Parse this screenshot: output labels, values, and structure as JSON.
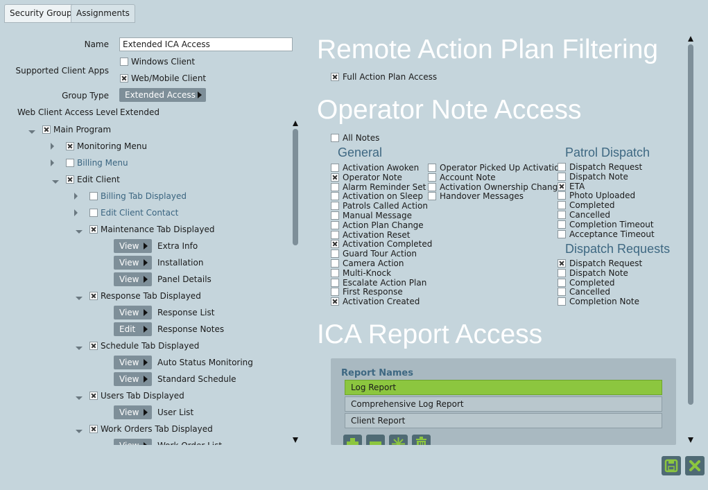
{
  "tabs": [
    "Security Group",
    "Assignments"
  ],
  "form": {
    "name_label": "Name",
    "name_value": "Extended ICA Access",
    "client_apps_label": "Supported Client Apps",
    "client_apps": [
      {
        "label": "Windows Client",
        "checked": false
      },
      {
        "label": "Web/Mobile Client",
        "checked": true
      }
    ],
    "group_type_label": "Group Type",
    "group_type_value": "Extended Access",
    "web_access_label": "Web Client Access Level",
    "web_access_value": "Extended"
  },
  "tree": [
    {
      "label": "Main Program",
      "checked": true
    },
    {
      "label": "Monitoring Menu",
      "checked": true
    },
    {
      "label": "Billing Menu",
      "checked": false
    },
    {
      "label": "Edit Client",
      "checked": true
    },
    {
      "label": "Billing Tab Displayed",
      "checked": false
    },
    {
      "label": "Edit Client Contact",
      "checked": false
    },
    {
      "label": "Maintenance Tab Displayed",
      "checked": true
    },
    {
      "mode": "View",
      "label": "Extra Info"
    },
    {
      "mode": "View",
      "label": "Installation"
    },
    {
      "mode": "View",
      "label": "Panel Details"
    },
    {
      "label": "Response Tab Displayed",
      "checked": true
    },
    {
      "mode": "View",
      "label": "Response List"
    },
    {
      "mode": "Edit",
      "label": "Response Notes"
    },
    {
      "label": "Schedule Tab Displayed",
      "checked": true
    },
    {
      "mode": "View",
      "label": "Auto Status Monitoring"
    },
    {
      "mode": "View",
      "label": "Standard Schedule"
    },
    {
      "label": "Users Tab Displayed",
      "checked": true
    },
    {
      "mode": "View",
      "label": "User List"
    },
    {
      "label": "Work Orders Tab Displayed",
      "checked": true
    },
    {
      "mode": "View",
      "label": "Work Order List"
    }
  ],
  "remote": {
    "title": "Remote Action Plan Filtering",
    "full_access": {
      "label": "Full Action Plan Access",
      "checked": true
    }
  },
  "operator_notes": {
    "title": "Operator Note Access",
    "all_notes": {
      "label": "All Notes",
      "checked": false
    },
    "general_heading": "General",
    "general_col1": [
      {
        "label": "Activation Awoken",
        "checked": false
      },
      {
        "label": "Operator Note",
        "checked": true
      },
      {
        "label": "Alarm Reminder Set",
        "checked": false
      },
      {
        "label": "Activation on Sleep",
        "checked": false
      },
      {
        "label": "Patrols Called Action",
        "checked": false
      },
      {
        "label": "Manual Message",
        "checked": false
      },
      {
        "label": "Action Plan Change",
        "checked": false
      },
      {
        "label": "Activation Reset",
        "checked": false
      },
      {
        "label": "Activation Completed",
        "checked": true
      },
      {
        "label": "Guard Tour Action",
        "checked": false
      },
      {
        "label": "Camera Action",
        "checked": false
      },
      {
        "label": "Multi-Knock",
        "checked": false
      },
      {
        "label": "Escalate Action Plan",
        "checked": false
      },
      {
        "label": "First Response",
        "checked": false
      },
      {
        "label": "Activation Created",
        "checked": true
      }
    ],
    "general_col2": [
      {
        "label": "Operator Picked Up Activation",
        "checked": false
      },
      {
        "label": "Account Note",
        "checked": false
      },
      {
        "label": "Activation Ownership Change",
        "checked": false
      },
      {
        "label": "Handover Messages",
        "checked": false
      }
    ],
    "patrol_heading": "Patrol Dispatch",
    "patrol": [
      {
        "label": "Dispatch Request",
        "checked": false
      },
      {
        "label": "Dispatch Note",
        "checked": false
      },
      {
        "label": "ETA",
        "checked": true
      },
      {
        "label": "Photo Uploaded",
        "checked": false
      },
      {
        "label": "Completed",
        "checked": false
      },
      {
        "label": "Cancelled",
        "checked": false
      },
      {
        "label": "Completion Timeout",
        "checked": false
      },
      {
        "label": "Acceptance Timeout",
        "checked": false
      }
    ],
    "dispatch_heading": "Dispatch Requests",
    "dispatch": [
      {
        "label": "Dispatch Request",
        "checked": true
      },
      {
        "label": "Dispatch Note",
        "checked": false
      },
      {
        "label": "Completed",
        "checked": false
      },
      {
        "label": "Cancelled",
        "checked": false
      },
      {
        "label": "Completion Note",
        "checked": false
      }
    ]
  },
  "ica": {
    "title": "ICA Report Access",
    "report_names_label": "Report Names",
    "reports": [
      "Log Report",
      "Comprehensive Log Report",
      "Client Report"
    ],
    "selected_index": 0
  },
  "icons": {
    "add": "plus-icon",
    "remove": "minus-icon",
    "sparkle": "sparkle-icon",
    "delete": "trash-icon",
    "save": "save-icon",
    "close": "close-icon"
  },
  "colors": {
    "background": "#c5d5dc",
    "heading": "#ffffff",
    "subheading": "#3e6882",
    "selected_row": "#8cc63f",
    "dark_button": "#4f6a74"
  }
}
